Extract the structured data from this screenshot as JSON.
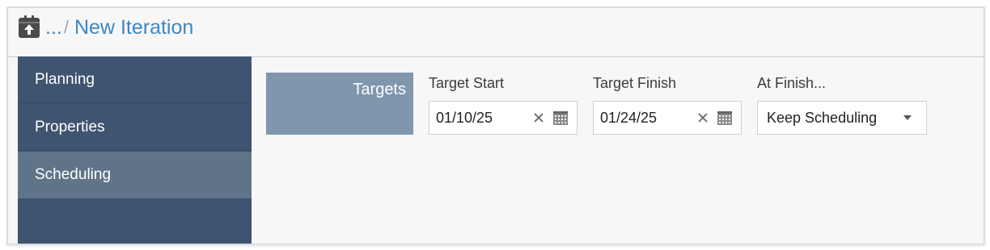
{
  "header": {
    "icon": "calendar-upload-icon",
    "breadcrumb_ellipsis": "...",
    "breadcrumb_separator": "/",
    "title": "New Iteration"
  },
  "sidebar": {
    "items": [
      {
        "label": "Planning",
        "active": false
      },
      {
        "label": "Properties",
        "active": false
      },
      {
        "label": "Scheduling",
        "active": true
      }
    ]
  },
  "main": {
    "section_label": "Targets",
    "target_start": {
      "label": "Target Start",
      "value": "01/10/25",
      "clear_icon": "close-icon",
      "calendar_icon": "calendar-icon"
    },
    "target_finish": {
      "label": "Target Finish",
      "value": "01/24/25",
      "clear_icon": "close-icon",
      "calendar_icon": "calendar-icon"
    },
    "at_finish": {
      "label": "At Finish...",
      "value": "Keep Scheduling",
      "caret_icon": "caret-down-icon"
    }
  },
  "colors": {
    "accent_link": "#3a87c8",
    "sidebar_bg": "#3f5470",
    "sidebar_active": "#607489",
    "targets_bg": "#7f96ad"
  }
}
